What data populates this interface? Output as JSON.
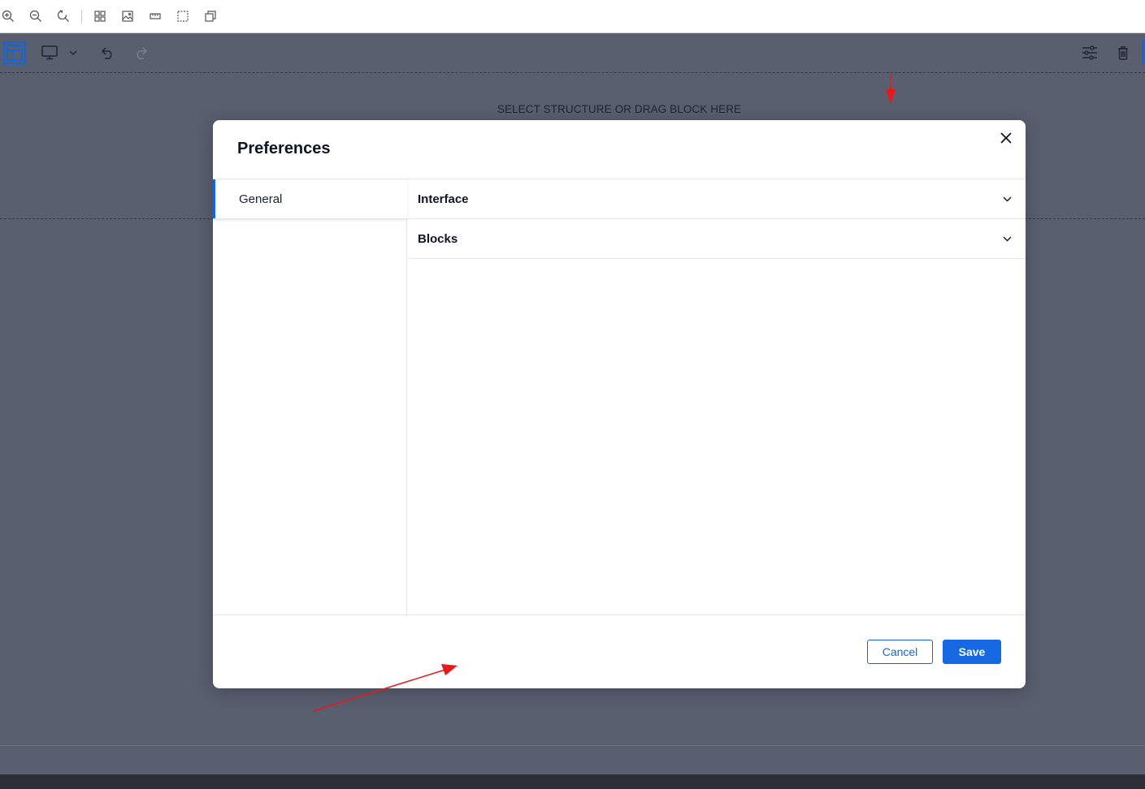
{
  "top_toolbar": {
    "icons": [
      "zoom-in-icon",
      "zoom-out-icon",
      "zoom-reset-icon",
      "grid-icon",
      "image-icon",
      "ruler-icon",
      "select-area-icon",
      "copy-icon"
    ]
  },
  "editor_bar": {
    "icons": [
      "layout-icon",
      "desktop-icon",
      "chevron-down-icon",
      "undo-icon",
      "redo-icon",
      "settings-sliders-icon",
      "trash-icon"
    ]
  },
  "canvas": {
    "drop_hint": "SELECT STRUCTURE OR DRAG BLOCK HERE"
  },
  "modal": {
    "title": "Preferences",
    "sidebar": {
      "tabs": [
        {
          "label": "General",
          "active": true
        }
      ]
    },
    "sections": [
      {
        "label": "Interface",
        "expanded": false
      },
      {
        "label": "Blocks",
        "expanded": false
      }
    ],
    "footer": {
      "cancel_label": "Cancel",
      "save_label": "Save"
    }
  },
  "colors": {
    "accent": "#1565d8",
    "canvas_bg": "#5a5f70",
    "annotation": "#e8181b"
  }
}
